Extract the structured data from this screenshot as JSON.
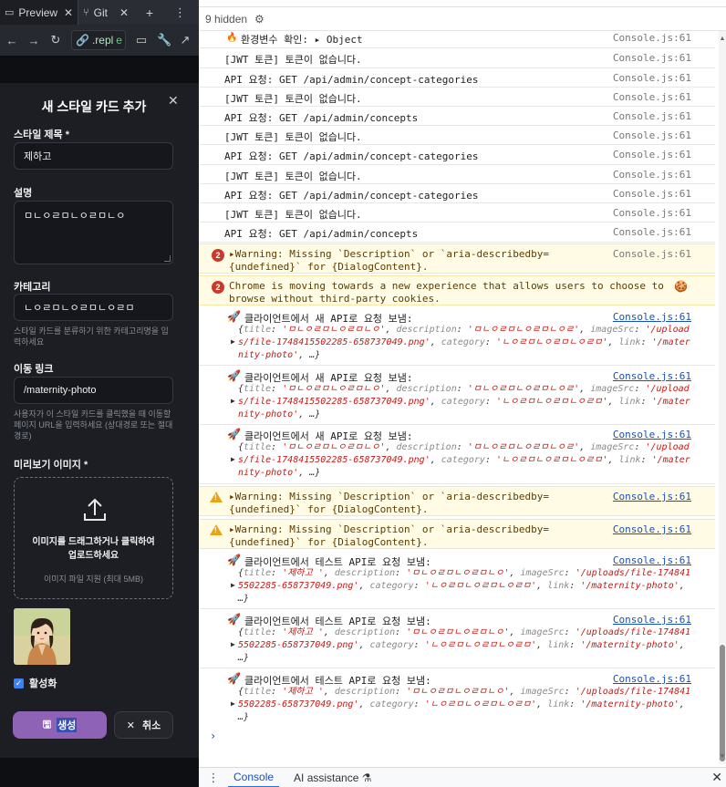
{
  "replit": {
    "tabs": [
      {
        "label": "Preview"
      },
      {
        "label": "Git"
      }
    ],
    "url_domain": ".repl",
    "url_path": "e"
  },
  "modal": {
    "title": "새 스타일 카드 추가",
    "style_title_label": "스타일 제목 *",
    "style_title_value": "제하고",
    "description_label": "설명",
    "description_value": "ㅁㄴㅇㄹㅁㄴㅇㄹㅁㄴㅇ",
    "category_label": "카테고리",
    "category_value": "ㄴㅇㄹㅁㄴㅇㄹㅁㄴㅇㄹㅁ",
    "category_helper": "스타일 카드를 분류하기 위한 카테고리명을 입력하세요",
    "link_label": "이동 링크",
    "link_value": "/maternity-photo",
    "link_helper": "사용자가 이 스타일 카드를 클릭했을 때 이동할 페이지 URL을 입력하세요 (상대경로 또는 절대경로)",
    "preview_label": "미리보기 이미지 *",
    "drop_text": "이미지를 드래그하거나 클릭하여 업로드하세요",
    "drop_sub": "이미지 파일 지원 (최대 5MB)",
    "active_label": "활성화",
    "create_label": "생성",
    "cancel_label": "취소"
  },
  "devtools": {
    "hidden_count": "9 hidden",
    "rows": [
      {
        "msg": "환경변수 확인: ▸ Object",
        "src": "Console.js:61"
      },
      {
        "msg": "[JWT 토큰] 토큰이 없습니다.",
        "src": "Console.js:61"
      },
      {
        "msg": "API 요청: GET /api/admin/concept-categories",
        "src": "Console.js:61"
      },
      {
        "msg": "[JWT 토큰] 토큰이 없습니다.",
        "src": "Console.js:61"
      },
      {
        "msg": "API 요청: GET /api/admin/concepts",
        "src": "Console.js:61"
      },
      {
        "msg": "[JWT 토큰] 토큰이 없습니다.",
        "src": "Console.js:61"
      },
      {
        "msg": "API 요청: GET /api/admin/concept-categories",
        "src": "Console.js:61"
      },
      {
        "msg": "[JWT 토큰] 토큰이 없습니다.",
        "src": "Console.js:61"
      },
      {
        "msg": "API 요청: GET /api/admin/concept-categories",
        "src": "Console.js:61"
      },
      {
        "msg": "[JWT 토큰] 토큰이 없습니다.",
        "src": "Console.js:61"
      },
      {
        "msg": "API 요청: GET /api/admin/concepts",
        "src": "Console.js:61"
      }
    ],
    "error1": {
      "badge": "2",
      "msg": "▸Warning: Missing `Description` or `aria-describedby={undefined}` for {DialogContent}.",
      "src": "Console.js:61"
    },
    "error2": {
      "badge": "2",
      "msg": "Chrome is moving towards a new experience that allows users to choose to browse without third-party cookies."
    },
    "new_api_rows": [
      {
        "msg": "클라이언트에서 새 API로 요청 보냄:",
        "src": "Console.js:61",
        "title": "'ㅁㄴㅇㄹㅁㄴㅇㄹㅁㄴㅇ'",
        "description": "'ㅁㄴㅇㄹㅁㄴㅇㄹㅁㄴㅇㄹ'",
        "imageSrc": "'/uploads/file-1748415502285-658737049.png'",
        "category": "'ㄴㅇㄹㅁㄴㅇㄹㅁㄴㅇㄹㅁ'",
        "link": "'/maternity-photo'"
      },
      {
        "msg": "클라이언트에서 새 API로 요청 보냄:",
        "src": "Console.js:61",
        "title": "'ㅁㄴㅇㄹㅁㄴㅇㄹㅁㄴㅇ'",
        "description": "'ㅁㄴㅇㄹㅁㄴㅇㄹㅁㄴㅇㄹ'",
        "imageSrc": "'/uploads/file-1748415502285-658737049.png'",
        "category": "'ㄴㅇㄹㅁㄴㅇㄹㅁㄴㅇㄹㅁ'",
        "link": "'/maternity-photo'"
      },
      {
        "msg": "클라이언트에서 새 API로 요청 보냄:",
        "src": "Console.js:61",
        "title": "'ㅁㄴㅇㄹㅁㄴㅇㄹㅁㄴㅇ'",
        "description": "'ㅁㄴㅇㄹㅁㄴㅇㄹㅁㄴㅇㄹ'",
        "imageSrc": "'/uploads/file-1748415502285-658737049.png'",
        "category": "'ㄴㅇㄹㅁㄴㅇㄹㅁㄴㅇㄹㅁ'",
        "link": "'/maternity-photo'"
      }
    ],
    "warn1": {
      "msg": "▸Warning: Missing `Description` or `aria-describedby={undefined}` for {DialogContent}.",
      "src": "Console.js:61"
    },
    "warn2": {
      "msg": "▸Warning: Missing `Description` or `aria-describedby={undefined}` for {DialogContent}.",
      "src": "Console.js:61"
    },
    "test_api_rows": [
      {
        "msg": "클라이언트에서 테스트 API로 요청 보냄:",
        "src": "Console.js:61",
        "title": "'제하고 '",
        "description": "'ㅁㄴㅇㄹㅁㄴㅇㄹㅁㄴㅇ'",
        "imageSrc": "'/uploads/file-1748415502285-658737049.png'",
        "category": "'ㄴㅇㄹㅁㄴㅇㄹㅁㄴㅇㄹㅁ'",
        "link": "'/maternity-photo'"
      },
      {
        "msg": "클라이언트에서 테스트 API로 요청 보냄:",
        "src": "Console.js:61",
        "title": "'제하고 '",
        "description": "'ㅁㄴㅇㄹㅁㄴㅇㄹㅁㄴㅇ'",
        "imageSrc": "'/uploads/file-1748415502285-658737049.png'",
        "category": "'ㄴㅇㄹㅁㄴㅇㄹㅁㄴㅇㄹㅁ'",
        "link": "'/maternity-photo'"
      },
      {
        "msg": "클라이언트에서 테스트 API로 요청 보냄:",
        "src": "Console.js:61",
        "title": "'제하고 '",
        "description": "'ㅁㄴㅇㄹㅁㄴㅇㄹㅁㄴㅇ'",
        "imageSrc": "'/uploads/file-1748415502285-658737049.png'",
        "category": "'ㄴㅇㄹㅁㄴㅇㄹㅁㄴㅇㄹㅁ'",
        "link": "'/maternity-photo'"
      }
    ],
    "drawer": {
      "console_tab": "Console",
      "ai_tab": "AI assistance ⚗"
    }
  },
  "colors": {
    "modal_bg": "#1c1e24",
    "create_button": "#8e63b6",
    "link_blue": "#1a4fb8",
    "string_red": "#c41a16",
    "warning_bg": "#fffbe5",
    "error_red": "#c93a2b"
  }
}
